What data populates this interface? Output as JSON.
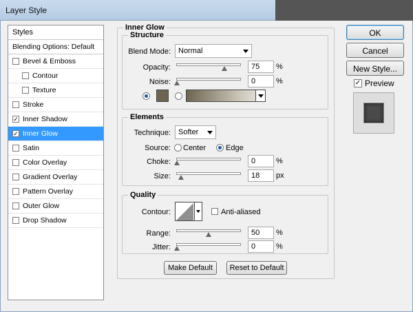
{
  "window": {
    "title": "Layer Style"
  },
  "styles_panel": {
    "header": "Styles",
    "blending": "Blending Options: Default",
    "items": [
      {
        "label": "Bevel & Emboss",
        "checked": false,
        "sub": false,
        "selected": false
      },
      {
        "label": "Contour",
        "checked": false,
        "sub": true,
        "selected": false
      },
      {
        "label": "Texture",
        "checked": false,
        "sub": true,
        "selected": false
      },
      {
        "label": "Stroke",
        "checked": false,
        "sub": false,
        "selected": false
      },
      {
        "label": "Inner Shadow",
        "checked": true,
        "sub": false,
        "selected": false
      },
      {
        "label": "Inner Glow",
        "checked": true,
        "sub": false,
        "selected": true
      },
      {
        "label": "Satin",
        "checked": false,
        "sub": false,
        "selected": false
      },
      {
        "label": "Color Overlay",
        "checked": false,
        "sub": false,
        "selected": false
      },
      {
        "label": "Gradient Overlay",
        "checked": false,
        "sub": false,
        "selected": false
      },
      {
        "label": "Pattern Overlay",
        "checked": false,
        "sub": false,
        "selected": false
      },
      {
        "label": "Outer Glow",
        "checked": false,
        "sub": false,
        "selected": false
      },
      {
        "label": "Drop Shadow",
        "checked": false,
        "sub": false,
        "selected": false
      }
    ]
  },
  "inner_glow": {
    "title": "Inner Glow",
    "structure": {
      "title": "Structure",
      "blend_mode_label": "Blend Mode:",
      "blend_mode": "Normal",
      "opacity_label": "Opacity:",
      "opacity": "75",
      "opacity_unit": "%",
      "opacity_level": 0.75,
      "noise_label": "Noise:",
      "noise": "0",
      "noise_unit": "%",
      "noise_level": 0,
      "glow_color": "#6e6550"
    },
    "elements": {
      "title": "Elements",
      "technique_label": "Technique:",
      "technique": "Softer",
      "source_label": "Source:",
      "source_center": "Center",
      "source_edge": "Edge",
      "choke_label": "Choke:",
      "choke": "0",
      "choke_unit": "%",
      "choke_level": 0,
      "size_label": "Size:",
      "size": "18",
      "size_unit": "px",
      "size_level": 0.07
    },
    "quality": {
      "title": "Quality",
      "contour_label": "Contour:",
      "anti_aliased": "Anti-aliased",
      "range_label": "Range:",
      "range": "50",
      "range_unit": "%",
      "range_level": 0.5,
      "jitter_label": "Jitter:",
      "jitter": "0",
      "jitter_unit": "%",
      "jitter_level": 0
    },
    "buttons": {
      "make_default": "Make Default",
      "reset_default": "Reset to Default"
    }
  },
  "actions": {
    "ok": "OK",
    "cancel": "Cancel",
    "new_style": "New Style...",
    "preview": "Preview",
    "preview_checked": true
  }
}
